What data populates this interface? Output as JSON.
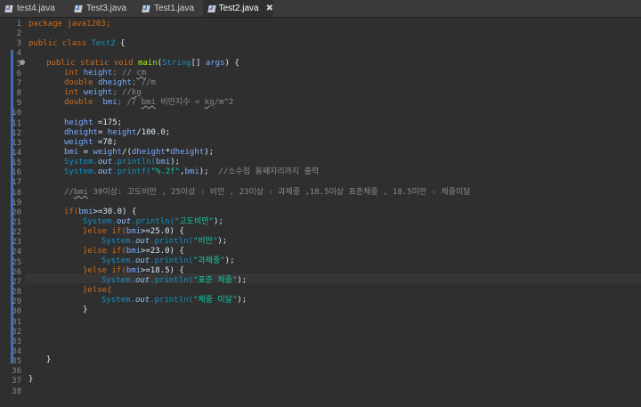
{
  "tabs": [
    {
      "label": "test4.java",
      "active": false
    },
    {
      "label": "Test3.java",
      "active": false
    },
    {
      "label": "Test1.java",
      "active": false
    },
    {
      "label": "Test2.java",
      "active": true
    }
  ],
  "close_glyph": "✖",
  "line_numbers": [
    "1",
    "2",
    "3",
    "4",
    "5",
    "6",
    "7",
    "8",
    "9",
    "10",
    "11",
    "12",
    "13",
    "14",
    "15",
    "16",
    "17",
    "18",
    "19",
    "20",
    "21",
    "22",
    "23",
    "24",
    "25",
    "26",
    "27",
    "28",
    "29",
    "30",
    "31",
    "32",
    "33",
    "34",
    "35",
    "36",
    "37",
    "38"
  ],
  "code": {
    "l1": "package java1203;",
    "l3a": "public class ",
    "l3b": "Test2",
    " l3c": " {",
    "l5a": "public static void ",
    "l5b": "main",
    "l5c": "(",
    "l5d": "String",
    "l5e": "[] ",
    "l5f": "args",
    "l5g": ") {",
    "l6a": "int ",
    "l6b": "height",
    "l6c": "; // ",
    "l6d": "cm",
    "l7a": "double ",
    "l7b": "dheight",
    "l7c": "; //m",
    "l8a": "int ",
    "l8b": "weight",
    "l8c": "; //",
    "l8d": "kg",
    "l9a": "double  ",
    "l9b": "bmi",
    "l9c": "; // ",
    "l9d": "bmi",
    " l9e": " 비만지수 = ",
    "l9f": "kg",
    "l9g": "/m^2",
    "l11a": "height",
    "l11b": " =175;",
    "l12a": "dheight",
    "l12b": "= ",
    "l12c": "height",
    "l12d": "/100.0;",
    "l13a": "weight",
    "l13b": " =78;",
    "l14a": "bmi",
    "l14b": " = ",
    "l14c": "weight",
    "l14d": "/(",
    "l14e": "dheight",
    "l14f": "*",
    "l14g": "dheight",
    "l14h": ");",
    "l15a": "System.",
    "l15b": "out",
    "l15c": ".println(",
    "l15d": "bmi",
    "l15e": ");",
    "l16a": "System.",
    "l16b": "out",
    "l16c": ".printf(",
    "l16d": "\"%.2f\"",
    "l16e": ",",
    "l16f": "bmi",
    "l16g": ");  ",
    "l16h": "//소수점 둘째자리까지 출력",
    "l18a": "//",
    "l18b": "bmi",
    " l18c": " 30이상: 고도비만 , 25이상 : 비만 , 23이상 : 과체중 ,18.5이상 표준체중 , 18.5미만 : 체중미달",
    "l20a": "if(",
    "l20b": "bmi",
    "l20c": ">=30.0) {",
    "l21a": "System.",
    "l21b": "out",
    "l21c": ".println(",
    "l21d": "\"고도비만\"",
    "l21e": ");",
    "l22a": "}else if(",
    "l22b": "bmi",
    "l22c": ">=25.0) {",
    "l23a": "System.",
    "l23b": "out",
    "l23c": ".println(",
    "l23d": "\"비만\"",
    "l23e": ");",
    "l24a": "}else if(",
    "l24b": "bmi",
    "l24c": ">=23.0) {",
    "l25a": "System.",
    "l25b": "out",
    "l25c": ".println(",
    "l25d": "\"과체중\"",
    "l25e": ");",
    "l26a": "}else if(",
    "l26b": "bmi",
    "l26c": ">=18.5) {",
    "l27a": "System.",
    "l27b": "out",
    "l27c": ".println(",
    "l27d": "\"표준 체중\"",
    "l27e": ");",
    "l28a": "}else{",
    "l29a": "System.",
    "l29b": "out",
    "l29c": ".println(",
    "l29d": "\"체중 미달\"",
    "l29e": ");",
    "l30a": "}",
    "l35a": "}",
    "l37a": "}"
  },
  "colors": {
    "background": "#2f2f2f",
    "keyword": "#cc6c1d",
    "type": "#1290c3",
    "method": "#a7ec21",
    "field": "#79abff",
    "string": "#17c6a3",
    "comment": "#8a8a8a",
    "change_marker": "#3f6db6"
  }
}
